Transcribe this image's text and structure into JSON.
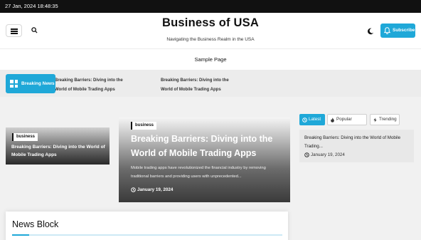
{
  "topbar": {
    "datetime": "27 Jan, 2024 18:48:35"
  },
  "header": {
    "site_title": "Business of USA",
    "tagline": "Navigating the Business Realm in the USA",
    "subscribe_label": "Subscribe"
  },
  "nav": {
    "items": [
      {
        "label": "Sample Page"
      }
    ]
  },
  "ticker": {
    "label": "Breaking News",
    "items": [
      {
        "title": "Breaking Barriers: Diving into the World of Mobile Trading Apps"
      },
      {
        "title": "Breaking Barriers: Diving into the World of Mobile Trading Apps"
      }
    ]
  },
  "featured": {
    "left": {
      "category": "business",
      "title": "Breaking Barriers: Diving into the World of Mobile Trading Apps"
    },
    "main": {
      "category": "business",
      "title": "Breaking Barriers: Diving into the World of Mobile Trading Apps",
      "excerpt": "Mobile trading apps have revolutionized the financial industry by removing traditional barriers and providing users with unprecedented...",
      "date": "January 19, 2024"
    }
  },
  "sidebar": {
    "tabs": [
      {
        "label": "Latest",
        "active": true
      },
      {
        "label": "Popular",
        "active": false
      },
      {
        "label": "Trending",
        "active": false
      }
    ],
    "post": {
      "title": "Breaking Barriers: Diving into the World of Mobile Trading...",
      "date": "January 19, 2024"
    }
  },
  "news_block": {
    "title": "News Block"
  },
  "colors": {
    "accent": "#1fa8d8",
    "topbar": "#111111"
  }
}
